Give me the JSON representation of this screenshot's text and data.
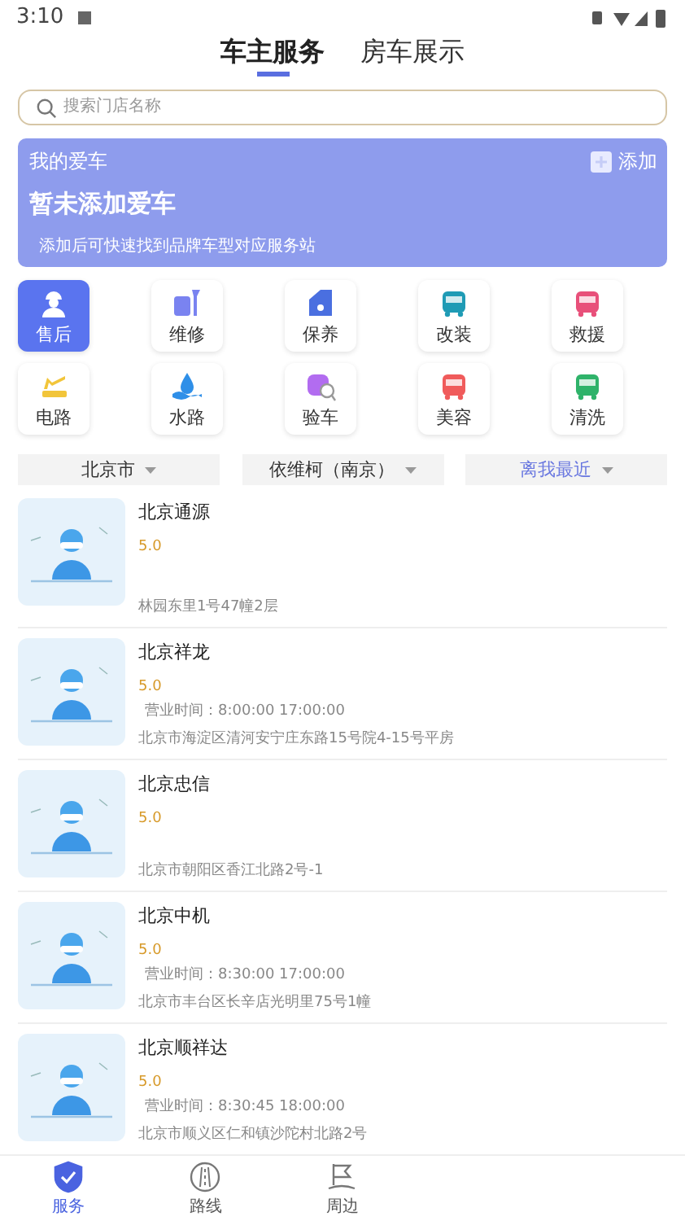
{
  "status_bar": {
    "time": "3:10"
  },
  "tabs": [
    {
      "label": "车主服务",
      "selected": true
    },
    {
      "label": "房车展示",
      "selected": false
    }
  ],
  "search": {
    "placeholder": "搜索门店名称"
  },
  "my_car": {
    "title": "我的爱车",
    "add_label": "添加",
    "empty_title": "暂未添加爱车",
    "hint": "添加后可快速找到品牌车型对应服务站"
  },
  "services": [
    {
      "label": "售后",
      "kind": "worker",
      "color": "#ffffff",
      "selected": true
    },
    {
      "label": "维修",
      "kind": "wrench",
      "color": "#7a83f0",
      "selected": false
    },
    {
      "label": "保养",
      "kind": "oilcan",
      "color": "#4a6fe0",
      "selected": false
    },
    {
      "label": "改装",
      "kind": "bus",
      "color": "#1f9bb5",
      "selected": false
    },
    {
      "label": "救援",
      "kind": "bus",
      "color": "#e8507a",
      "selected": false
    },
    {
      "label": "电路",
      "kind": "plug",
      "color": "#f2c53a",
      "selected": false
    },
    {
      "label": "水路",
      "kind": "drop",
      "color": "#2f8fe8",
      "selected": false
    },
    {
      "label": "验车",
      "kind": "inspect",
      "color": "#b26cf0",
      "selected": false
    },
    {
      "label": "美容",
      "kind": "bus",
      "color": "#f05b5b",
      "selected": false
    },
    {
      "label": "清洗",
      "kind": "bus",
      "color": "#2fb36a",
      "selected": false
    }
  ],
  "filters": [
    {
      "label": "北京市",
      "selected": false
    },
    {
      "label": "依维柯（南京）",
      "selected": false
    },
    {
      "label": "离我最近",
      "selected": true
    }
  ],
  "stores": [
    {
      "name": "北京通源",
      "rating": "5.0",
      "address": "林园东里1号47幢2层"
    },
    {
      "name": "北京祥龙",
      "rating": "5.0",
      "hours": "营业时间：8:00:00 17:00:00",
      "address": "北京市海淀区清河安宁庄东路15号院4-15号平房"
    },
    {
      "name": "北京忠信",
      "rating": "5.0",
      "address": "北京市朝阳区香江北路2号-1"
    },
    {
      "name": "北京中机",
      "rating": "5.0",
      "hours": "营业时间：8:30:00 17:00:00",
      "address": "北京市丰台区长辛店光明里75号1幢"
    },
    {
      "name": "北京顺祥达",
      "rating": "5.0",
      "hours": "营业时间：8:30:45 18:00:00",
      "address": "北京市顺义区仁和镇沙陀村北路2号"
    }
  ],
  "bottom_nav": [
    {
      "label": "服务",
      "kind": "shield",
      "selected": true
    },
    {
      "label": "路线",
      "kind": "road",
      "selected": false
    },
    {
      "label": "周边",
      "kind": "flag",
      "selected": false
    }
  ]
}
